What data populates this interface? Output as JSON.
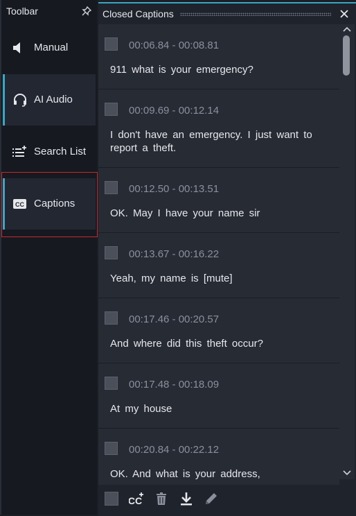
{
  "toolbar": {
    "title": "Toolbar",
    "items": [
      {
        "label": "Manual",
        "icon": "speaker-icon"
      },
      {
        "label": "AI Audio",
        "icon": "headset-icon"
      },
      {
        "label": "Search List",
        "icon": "list-add-icon"
      },
      {
        "label": "Captions",
        "icon": "cc-icon"
      }
    ]
  },
  "panel": {
    "title": "Closed Captions",
    "captions": [
      {
        "time": "00:06.84 - 00:08.81",
        "text": "911 what is your emergency?"
      },
      {
        "time": "00:09.69 - 00:12.14",
        "text": "I don't have an emergency. I just want to report a theft."
      },
      {
        "time": "00:12.50 - 00:13.51",
        "text": "OK. May I have your name sir"
      },
      {
        "time": "00:13.67 - 00:16.22",
        "text": "Yeah, my name is [mute]"
      },
      {
        "time": "00:17.46 - 00:20.57",
        "text": "And where did this theft occur?"
      },
      {
        "time": "00:17.48 - 00:18.09",
        "text": "At my house"
      },
      {
        "time": "00:20.84 - 00:22.12",
        "text": "OK. And what is your address,"
      }
    ]
  },
  "colors": {
    "accent": "#3aa7c4",
    "selection_border": "#c8282e",
    "background": "#1b1e25"
  }
}
